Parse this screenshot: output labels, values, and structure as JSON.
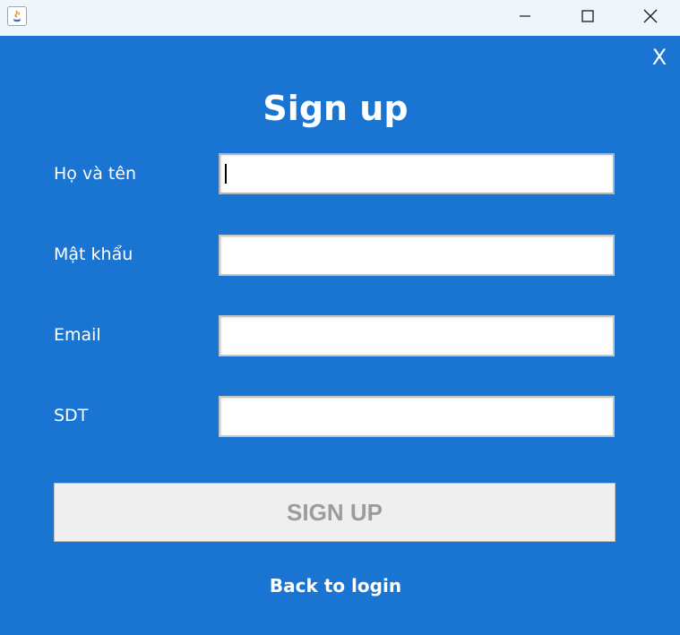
{
  "window": {
    "controls": {
      "minimize_icon": "minimize-icon",
      "maximize_icon": "maximize-icon",
      "close_icon": "close-icon"
    }
  },
  "form": {
    "close_label": "X",
    "title": "Sign up",
    "fields": [
      {
        "label": "Họ và tên",
        "value": "",
        "focused": true
      },
      {
        "label": "Mật khẩu",
        "value": ""
      },
      {
        "label": "Email",
        "value": ""
      },
      {
        "label": "SDT",
        "value": ""
      }
    ],
    "submit_label": "SIGN UP",
    "back_link": "Back to login"
  },
  "colors": {
    "background": "#1a75d2",
    "titlebar": "#eef5fb",
    "button_bg": "#efefef",
    "button_text": "#9c9c9c",
    "text": "#ffffff"
  }
}
